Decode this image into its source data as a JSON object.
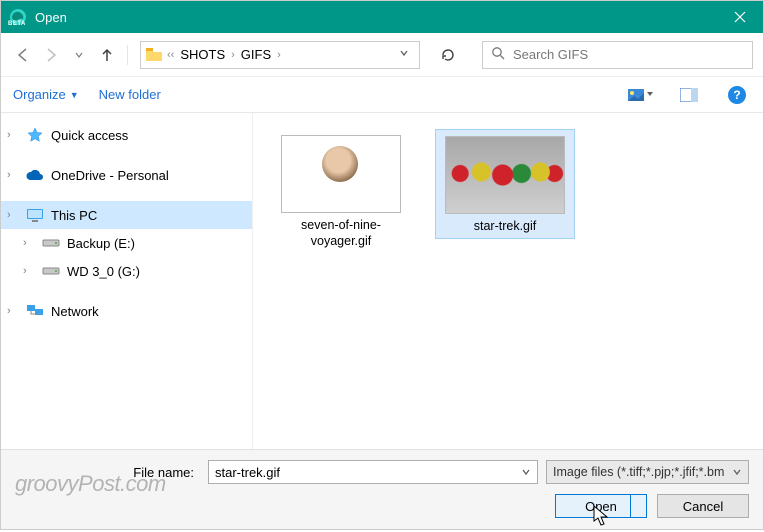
{
  "titlebar": {
    "title": "Open",
    "beta": "BETA"
  },
  "breadcrumb": {
    "items": [
      "SHOTS",
      "GIFS"
    ]
  },
  "search": {
    "placeholder": "Search GIFS"
  },
  "toolbar": {
    "organize": "Organize",
    "new_folder": "New folder"
  },
  "sidebar": {
    "items": [
      {
        "label": "Quick access",
        "icon": "star"
      },
      {
        "label": "OneDrive - Personal",
        "icon": "cloud"
      },
      {
        "label": "This PC",
        "icon": "pc",
        "selected": true
      },
      {
        "label": "Backup (E:)",
        "icon": "drive"
      },
      {
        "label": "WD 3_0 (G:)",
        "icon": "drive"
      },
      {
        "label": "Network",
        "icon": "network"
      }
    ]
  },
  "files": [
    {
      "name": "seven-of-nine-voyager.gif",
      "selected": false,
      "thumb": "a"
    },
    {
      "name": "star-trek.gif",
      "selected": true,
      "thumb": "b"
    }
  ],
  "bottom": {
    "filename_label": "File name:",
    "filename_value": "star-trek.gif",
    "filter_label": "Image files (*.tiff;*.pjp;*.jfif;*.bm",
    "open": "Open",
    "cancel": "Cancel"
  },
  "watermark": "groovyPost.com"
}
